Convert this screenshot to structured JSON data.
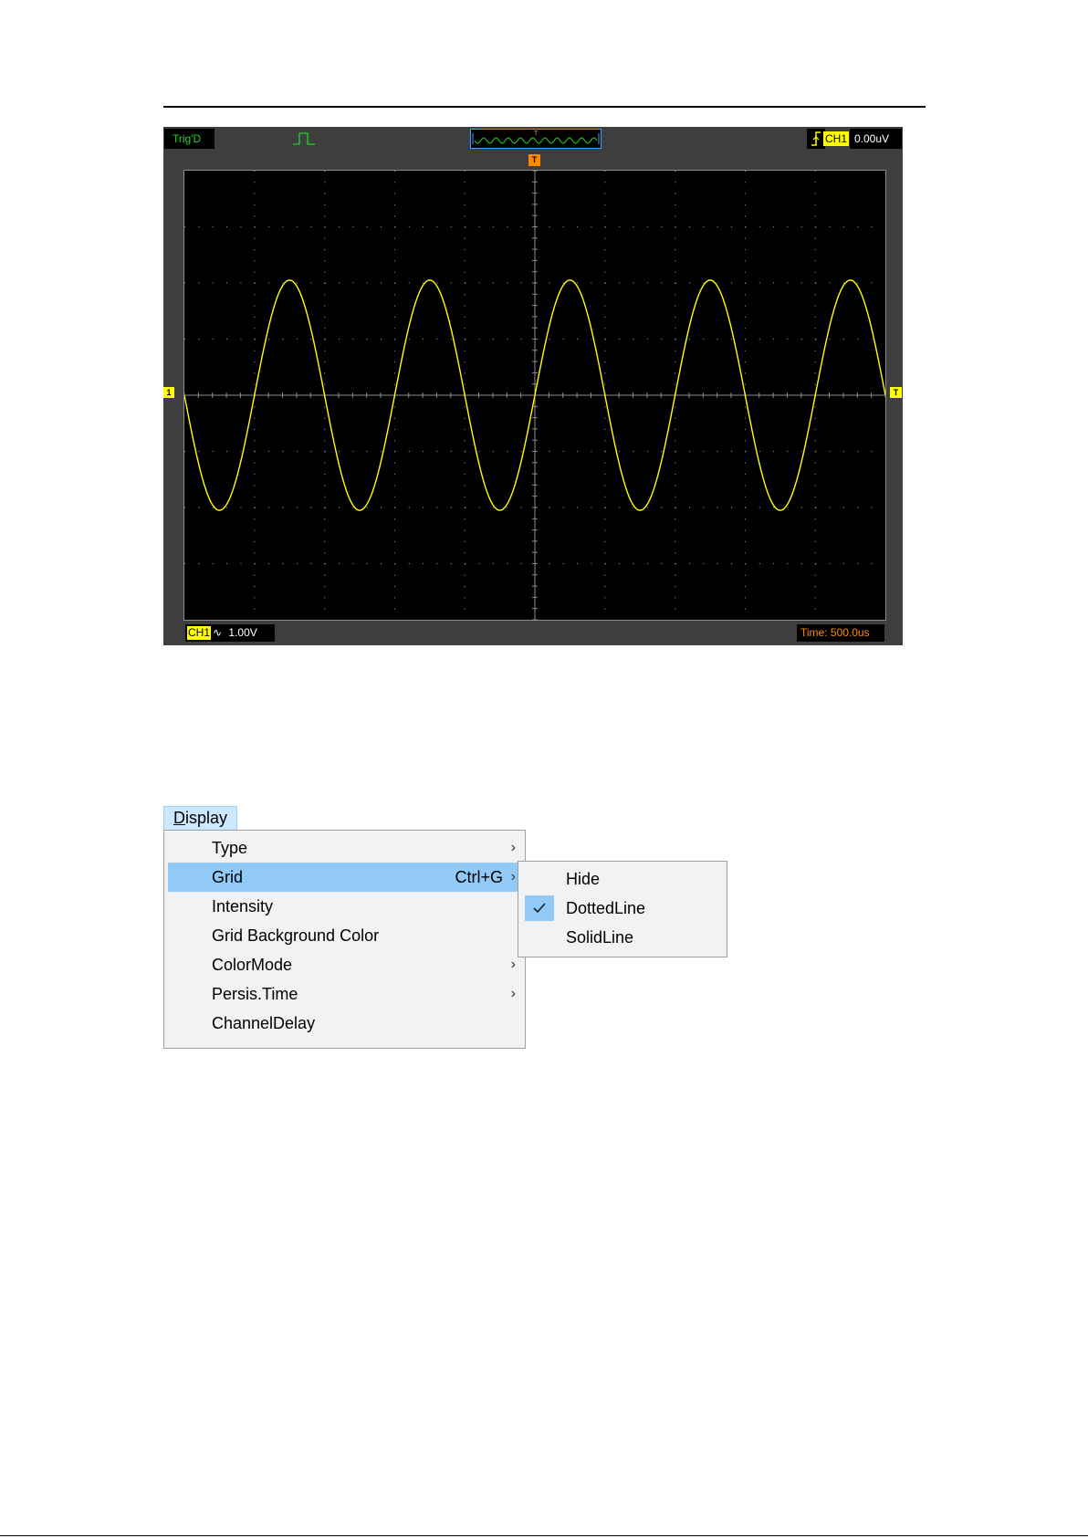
{
  "scope": {
    "trigger_status": "Trig'D",
    "trigger_channel": "CH1",
    "trigger_level": "0.00uV",
    "trigger_marker": "T",
    "ch1_marker": "1",
    "trigger_level_marker": "T",
    "channel_label": "CH1",
    "coupling_symbol": "∿",
    "volts_per_div": "1.00V",
    "timebase": "Time: 500.0us",
    "icons": [
      "pulse-icon",
      "waveform-preview-icon",
      "rising-edge-icon"
    ],
    "colors": {
      "trace": "#ffff00",
      "status": "#22d622",
      "trigger": "#ff8a00",
      "grid": "#8c8c8c"
    },
    "grid_style": "dotted",
    "waveform": {
      "type": "sine",
      "amplitude_div": 2.05,
      "cycles_on_screen": 5,
      "phase": "negative-going at left edge"
    }
  },
  "menu": {
    "title": "Display",
    "title_mnemonic": "D",
    "title_rest": "isplay",
    "items": [
      {
        "label": "Type",
        "shortcut": "",
        "submenu": true
      },
      {
        "label": "Grid",
        "shortcut": "Ctrl+G",
        "submenu": true,
        "highlighted": true
      },
      {
        "label": "Intensity",
        "shortcut": "",
        "submenu": false
      },
      {
        "label": "Grid Background Color",
        "shortcut": "",
        "submenu": false
      },
      {
        "label": "ColorMode",
        "shortcut": "",
        "submenu": true
      },
      {
        "label": "Persis.Time",
        "shortcut": "",
        "submenu": true
      },
      {
        "label": "ChannelDelay",
        "shortcut": "",
        "submenu": false
      }
    ],
    "arrow": "›",
    "grid_submenu": [
      {
        "label": "Hide",
        "checked": false
      },
      {
        "label": "DottedLine",
        "checked": true
      },
      {
        "label": "SolidLine",
        "checked": false
      }
    ]
  }
}
